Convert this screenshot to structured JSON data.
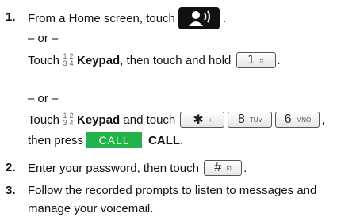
{
  "steps": [
    {
      "number": "1.",
      "text": "From a Home screen, touch",
      "end": "."
    },
    {
      "number": "2.",
      "text": "Enter your password, then touch",
      "end": "."
    },
    {
      "number": "3.",
      "line1": "Follow the recorded prompts to listen to messages and",
      "line2": "manage your voicemail."
    }
  ],
  "or_text": "– or –",
  "alt1": {
    "touch": "Touch",
    "keypad_label": "Keypad",
    "mid": ", then touch and hold",
    "end": "."
  },
  "alt2": {
    "touch": "Touch",
    "keypad_label": "Keypad",
    "mid": "and touch",
    "end": ",",
    "line2_start": "then press",
    "call_button": "CALL",
    "call_label": "CALL",
    "line2_end": "."
  },
  "keypad_icon_digits": [
    "1",
    "2",
    "3",
    "4"
  ],
  "keys": {
    "one": {
      "main": "1",
      "sub": "⠶"
    },
    "star": {
      "main": "✱",
      "sub": "+"
    },
    "eight": {
      "main": "8",
      "sub": "TUV"
    },
    "six": {
      "main": "6",
      "sub": "MNO"
    },
    "hash": {
      "main": "#",
      "sub": "⊡"
    }
  },
  "colors": {
    "call_green": "#25b24a",
    "icon_bg": "#111111"
  },
  "icons": {
    "voicemail": "voicemail-person-icon"
  }
}
